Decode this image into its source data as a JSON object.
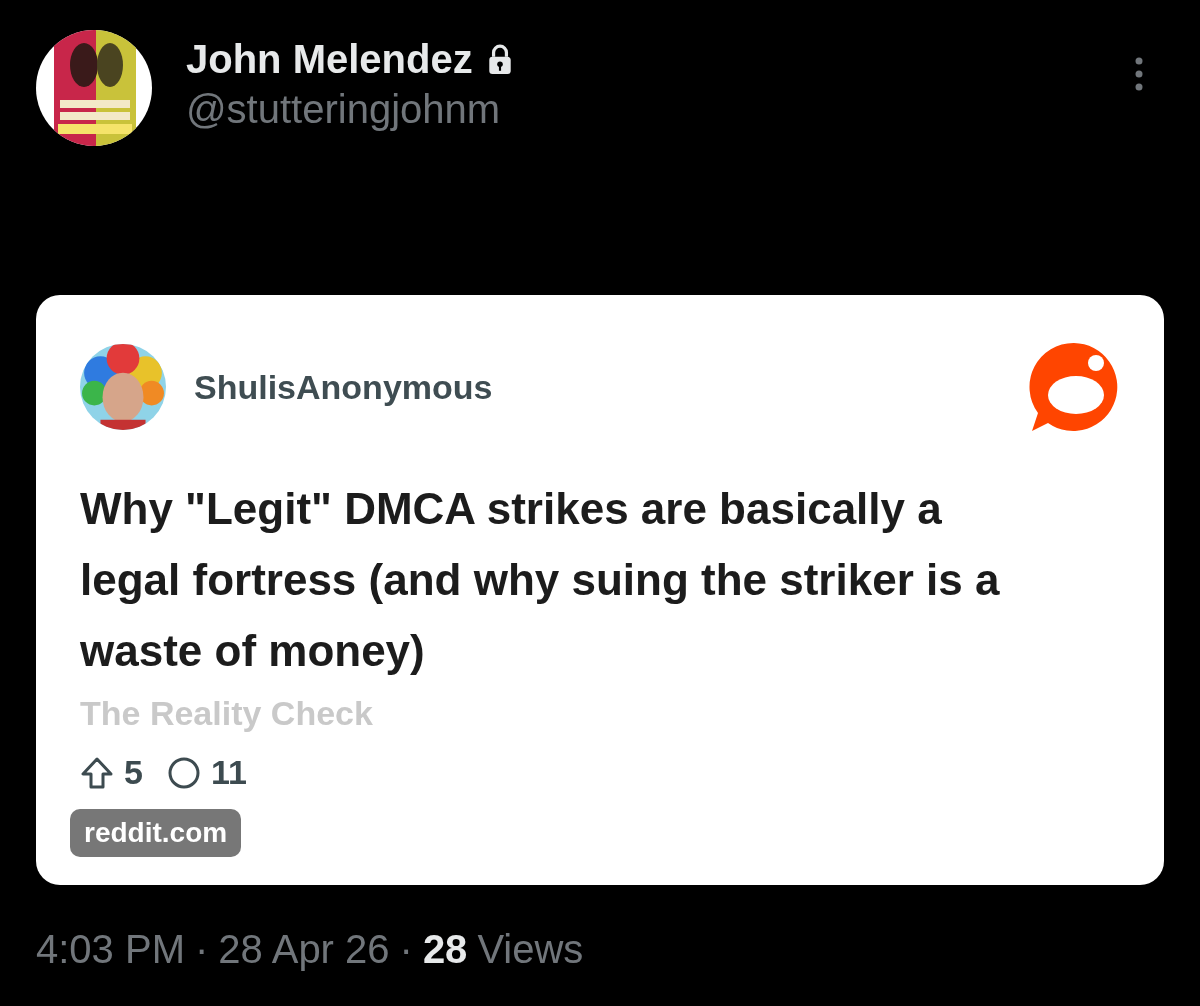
{
  "author": {
    "name": "John Melendez",
    "protected": true,
    "handle": "@stutteringjohnm"
  },
  "link_card": {
    "poster": "ShulisAnonymous",
    "title": "Why \"Legit\" DMCA strikes are basically a legal fortress (and why suing the striker is a waste of money)",
    "subtitle": "The Reality Check",
    "upvotes": "5",
    "comments": "11",
    "domain": "reddit.com"
  },
  "meta": {
    "time": "4:03 PM",
    "separators": [
      "·",
      "·"
    ],
    "date": "28 Apr 26",
    "views_count": "28",
    "views_label": "Views"
  }
}
